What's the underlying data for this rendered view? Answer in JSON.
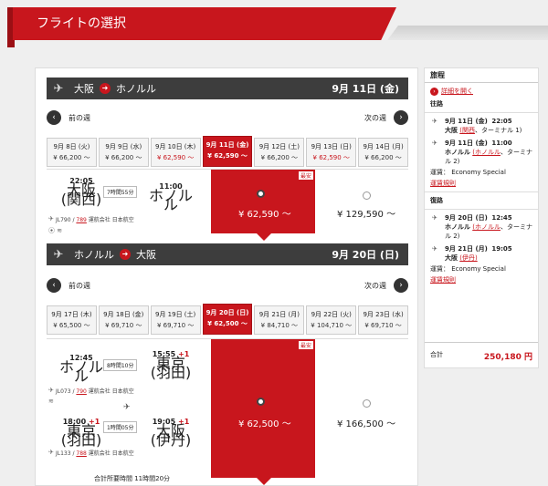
{
  "header": {
    "title": "フライトの選択"
  },
  "outbound": {
    "from": "大阪",
    "to": "ホノルル",
    "date": "9月 11日 (金)",
    "prev_week": "前の週",
    "next_week": "次の週",
    "days": [
      {
        "date": "9月 8日 (火)",
        "price": "¥ 66,200 〜"
      },
      {
        "date": "9月 9日 (水)",
        "price": "¥ 66,200 〜"
      },
      {
        "date": "9月 10日 (木)",
        "price": "¥ 62,590 〜"
      },
      {
        "date": "9月 11日 (金)",
        "price": "¥ 62,590 〜"
      },
      {
        "date": "9月 12日 (土)",
        "price": "¥ 66,200 〜"
      },
      {
        "date": "9月 13日 (日)",
        "price": "¥ 62,590 〜"
      },
      {
        "date": "9月 14日 (月)",
        "price": "¥ 66,200 〜"
      }
    ],
    "segment": {
      "dep_time": "22:05",
      "dep_city": "大阪",
      "dep_airport": "(関西)",
      "duration": "7時間55分",
      "arr_time": "11:00",
      "arr_city": "ホノルル",
      "flight_no": "JL790",
      "codeshare": "789",
      "operator": "運航会社 日本航空"
    },
    "badge": "最安",
    "fare_selected": "¥ 62,590 〜",
    "fare_other": "¥ 129,590 〜"
  },
  "inbound": {
    "from": "ホノルル",
    "to": "大阪",
    "date": "9月 20日 (日)",
    "prev_week": "前の週",
    "next_week": "次の週",
    "days": [
      {
        "date": "9月 17日 (木)",
        "price": "¥ 65,500 〜"
      },
      {
        "date": "9月 18日 (金)",
        "price": "¥ 69,710 〜"
      },
      {
        "date": "9月 19日 (土)",
        "price": "¥ 69,710 〜"
      },
      {
        "date": "9月 20日 (日)",
        "price": "¥ 62,500 〜"
      },
      {
        "date": "9月 21日 (月)",
        "price": "¥ 84,710 〜"
      },
      {
        "date": "9月 22日 (火)",
        "price": "¥ 104,710 〜"
      },
      {
        "date": "9月 23日 (水)",
        "price": "¥ 69,710 〜"
      }
    ],
    "segment1": {
      "dep_time": "12:45",
      "dep_city": "ホノルル",
      "duration": "8時間10分",
      "arr_time": "15:55",
      "arr_plus": "+1",
      "arr_city": "東京",
      "arr_airport": "(羽田)",
      "flight_no": "JL073",
      "codeshare": "790",
      "operator": "運航会社 日本航空"
    },
    "segment2": {
      "dep_time": "18:00",
      "dep_plus": "+1",
      "dep_city": "東京",
      "dep_airport": "(羽田)",
      "duration": "1時間05分",
      "arr_time": "19:05",
      "arr_plus": "+1",
      "arr_city": "大阪",
      "arr_airport": "(伊丹)",
      "flight_no": "JL133",
      "codeshare": "788",
      "operator": "運航会社 日本航空"
    },
    "total_time": "合計所要時間 11時間20分",
    "badge": "最安",
    "fare_selected": "¥ 62,500 〜",
    "fare_other": "¥ 166,500 〜"
  },
  "sidebar": {
    "title": "旅程",
    "detail_link": "詳細を開く",
    "outbound_label": "往路",
    "out_dep": {
      "date": "9月 11日 (金)",
      "time": "22:05",
      "city": "大阪",
      "airport": "(関西",
      "terminal": "、ターミナル 1)"
    },
    "out_arr": {
      "date": "9月 11日 (金)",
      "time": "11:00",
      "city": "ホノルル",
      "airport": "(ホノルル",
      "terminal": "、ターミナル 2)"
    },
    "out_fare": "運賃： Economy Special",
    "out_rule": "運賃規則",
    "inbound_label": "復路",
    "in_dep": {
      "date": "9月 20日 (日)",
      "time": "12:45",
      "city": "ホノルル",
      "airport": "(ホノルル",
      "terminal": "、ターミナル 2)"
    },
    "in_arr": {
      "date": "9月 21日 (月)",
      "time": "19:05",
      "city": "大阪",
      "airport": "(伊丹)"
    },
    "in_fare": "運賃： Economy Special",
    "in_rule": "運賃規則",
    "total_label": "合計",
    "total_value": "250,180 円"
  }
}
